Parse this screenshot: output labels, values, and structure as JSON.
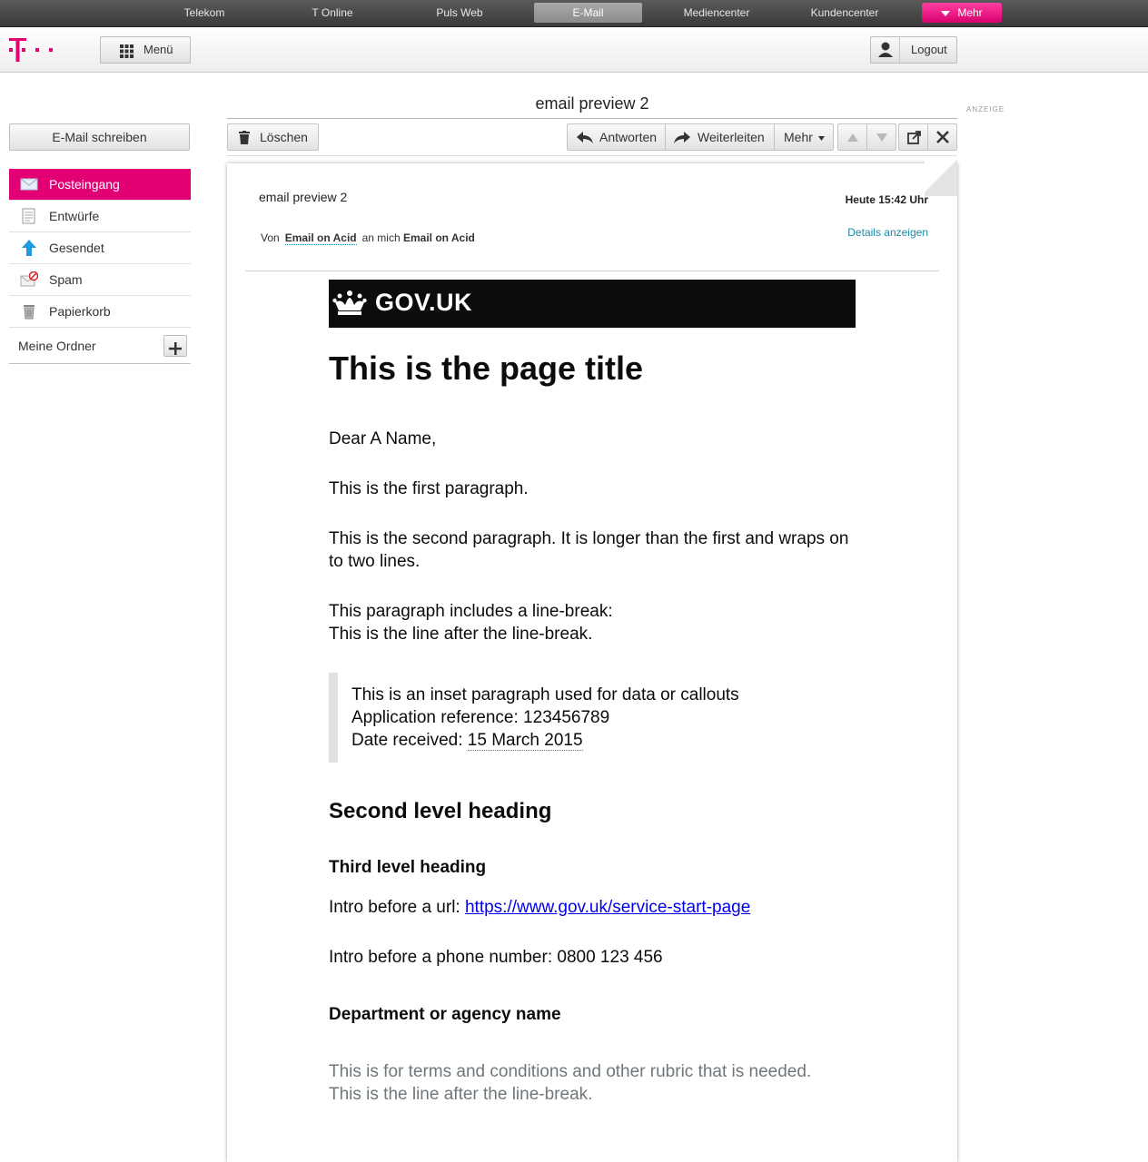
{
  "portal_nav": [
    {
      "label": "Telekom"
    },
    {
      "label": "T Online"
    },
    {
      "label": "Puls Web"
    },
    {
      "label": "E-Mail"
    },
    {
      "label": "Mediencenter"
    },
    {
      "label": "Kundencenter"
    }
  ],
  "portal_more_label": "Mehr",
  "header": {
    "menu_label": "Menü",
    "logout_label": "Logout"
  },
  "colors": {
    "brand_magenta": "#e20074",
    "link_teal": "#1a8aa8"
  },
  "subject_title": "email preview 2",
  "ad_label": "ANZEIGE",
  "sidebar": {
    "compose_label": "E-Mail schreiben",
    "folders": [
      {
        "label": "Posteingang",
        "icon": "inbox-icon",
        "active": true
      },
      {
        "label": "Entwürfe",
        "icon": "drafts-icon",
        "active": false
      },
      {
        "label": "Gesendet",
        "icon": "sent-icon",
        "active": false
      },
      {
        "label": "Spam",
        "icon": "spam-icon",
        "active": false
      },
      {
        "label": "Papierkorb",
        "icon": "trash-icon",
        "active": false
      }
    ],
    "my_folders_label": "Meine Ordner"
  },
  "toolbar": {
    "delete_label": "Löschen",
    "reply_label": "Antworten",
    "forward_label": "Weiterleiten",
    "more_label": "Mehr"
  },
  "message": {
    "subject": "email preview 2",
    "date": "Heute 15:42 Uhr",
    "from_prefix": "Von",
    "from_name": "Email on Acid",
    "to_prefix": "an mich",
    "to_name": "Email on Acid",
    "details_label": "Details anzeigen"
  },
  "email_body": {
    "logo_text": "GOV.UK",
    "title": "This is the page title",
    "greeting": "Dear A Name,",
    "para1": "This is the first paragraph.",
    "para2": "This is the second paragraph. It is longer than the first and wraps on to two lines.",
    "para3_line1": "This paragraph includes a line-break:",
    "para3_line2": "This is the line after the line-break.",
    "inset_line1": "This is an inset paragraph used for data or callouts",
    "inset_line2": "Application reference: 123456789",
    "inset_line3_prefix": "Date received: ",
    "inset_line3_date": "15 March 2015",
    "h2": "Second level heading",
    "h3": "Third level heading",
    "url_intro": "Intro before a url: ",
    "url": "https://www.gov.uk/service-start-page",
    "phone_intro": "Intro before a phone number: ",
    "phone": "0800 123 456",
    "department": "Department or agency name",
    "rubric_line1": "This is for terms and conditions and other rubric that is needed.",
    "rubric_line2": "This is the line after the line-break."
  }
}
